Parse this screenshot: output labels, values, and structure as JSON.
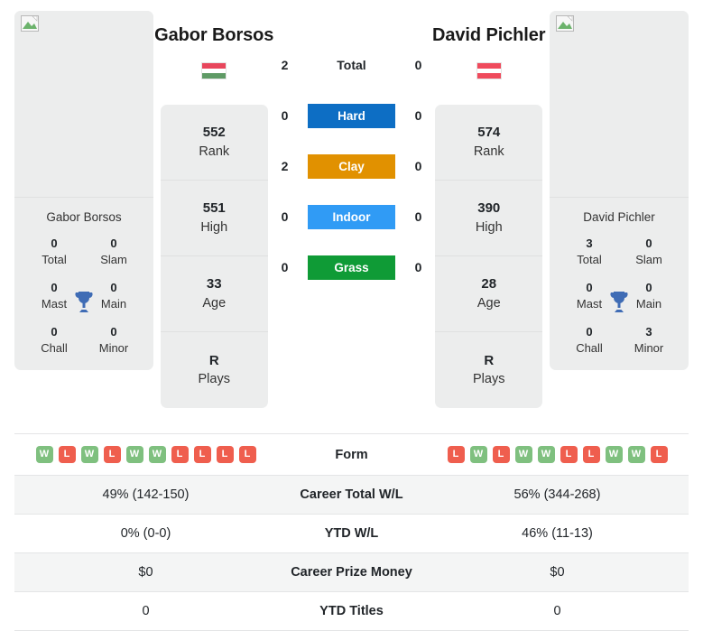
{
  "players": {
    "left": {
      "name": "Gabor Borsos",
      "card_name": "Gabor Borsos",
      "flag_name": "hungary-flag",
      "flag_colors": [
        "#e8465c",
        "#ffffff",
        "#5f9a65"
      ],
      "stats": [
        {
          "value": "552",
          "label": "Rank"
        },
        {
          "value": "551",
          "label": "High"
        },
        {
          "value": "33",
          "label": "Age"
        },
        {
          "value": "R",
          "label": "Plays"
        }
      ],
      "titles": [
        {
          "value": "0",
          "label": "Total"
        },
        {
          "value": "0",
          "label": "Slam"
        },
        {
          "value": "0",
          "label": "Mast"
        },
        {
          "value": "0",
          "label": "Main"
        },
        {
          "value": "0",
          "label": "Chall"
        },
        {
          "value": "0",
          "label": "Minor"
        }
      ],
      "form": [
        "W",
        "L",
        "W",
        "L",
        "W",
        "W",
        "L",
        "L",
        "L",
        "L"
      ],
      "career_wl": "49% (142-150)",
      "ytd_wl": "0% (0-0)",
      "career_prize_money": "$0",
      "ytd_titles": "0"
    },
    "right": {
      "name": "David Pichler",
      "card_name": "David Pichler",
      "flag_name": "austria-flag",
      "flag_colors": [
        "#ef4a5c",
        "#ffffff",
        "#ef4a5c"
      ],
      "stats": [
        {
          "value": "574",
          "label": "Rank"
        },
        {
          "value": "390",
          "label": "High"
        },
        {
          "value": "28",
          "label": "Age"
        },
        {
          "value": "R",
          "label": "Plays"
        }
      ],
      "titles": [
        {
          "value": "3",
          "label": "Total"
        },
        {
          "value": "0",
          "label": "Slam"
        },
        {
          "value": "0",
          "label": "Mast"
        },
        {
          "value": "0",
          "label": "Main"
        },
        {
          "value": "0",
          "label": "Chall"
        },
        {
          "value": "3",
          "label": "Minor"
        }
      ],
      "form": [
        "L",
        "W",
        "L",
        "W",
        "W",
        "L",
        "L",
        "W",
        "W",
        "L"
      ],
      "career_wl": "56% (344-268)",
      "ytd_wl": "46% (11-13)",
      "career_prize_money": "$0",
      "ytd_titles": "0"
    }
  },
  "head_to_head": [
    {
      "surface": "Total",
      "left": "2",
      "right": "0",
      "color": "transparent",
      "plain": true
    },
    {
      "surface": "Hard",
      "left": "0",
      "right": "0",
      "color": "#0d6ec4",
      "plain": false
    },
    {
      "surface": "Clay",
      "left": "2",
      "right": "0",
      "color": "#e19100",
      "plain": false
    },
    {
      "surface": "Indoor",
      "left": "0",
      "right": "0",
      "color": "#309bf5",
      "plain": false
    },
    {
      "surface": "Grass",
      "left": "0",
      "right": "0",
      "color": "#0f9b36",
      "plain": false
    }
  ],
  "table_rows": [
    {
      "label": "Form",
      "key": "form",
      "type": "form"
    },
    {
      "label": "Career Total W/L",
      "key": "career_wl",
      "type": "text"
    },
    {
      "label": "YTD W/L",
      "key": "ytd_wl",
      "type": "text"
    },
    {
      "label": "Career Prize Money",
      "key": "career_prize_money",
      "type": "text"
    },
    {
      "label": "YTD Titles",
      "key": "ytd_titles",
      "type": "text"
    }
  ],
  "icons": {
    "trophy": "trophy-icon",
    "broken_image": "broken-image-icon"
  },
  "colors": {
    "win": "#7fc07f",
    "loss": "#ef5e4e",
    "card_bg": "#eceded",
    "row_shade": "#f4f5f5"
  }
}
